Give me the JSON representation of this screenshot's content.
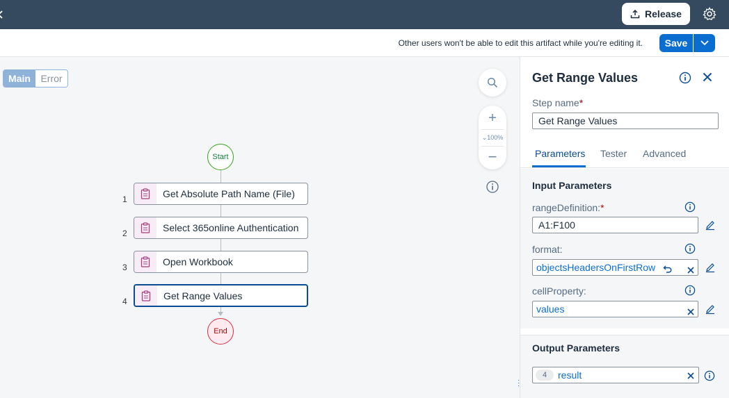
{
  "shell": {
    "release_label": "Release"
  },
  "toolbar": {
    "message": "Other users won't be able to edit this artifact while you're editing it.",
    "save_label": "Save"
  },
  "canvas": {
    "segments": [
      "Main",
      "Error"
    ],
    "selected_segment": "Main",
    "zoom_level": "100%",
    "start_label": "Start",
    "end_label": "End",
    "steps": [
      {
        "number": "1",
        "label": "Get Absolute Path Name (File)",
        "icon": "clipboard-icon"
      },
      {
        "number": "2",
        "label": "Select 365online Authentication",
        "icon": "clipboard-icon"
      },
      {
        "number": "3",
        "label": "Open Workbook",
        "icon": "clipboard-icon"
      },
      {
        "number": "4",
        "label": "Get Range Values",
        "icon": "clipboard-icon",
        "selected": true
      }
    ]
  },
  "panel": {
    "title": "Get Range Values",
    "step_name_label": "Step name",
    "step_name_value": "Get Range Values",
    "tabs": [
      "Parameters",
      "Tester",
      "Advanced"
    ],
    "active_tab": "Parameters",
    "input_section": "Input Parameters",
    "params": [
      {
        "label": "rangeDefinition:",
        "required": true,
        "value": "A1:F100"
      },
      {
        "label": "format:",
        "required": false,
        "value": "objectsHeadersOnFirstRow"
      },
      {
        "label": "cellProperty:",
        "required": false,
        "value": "values"
      }
    ],
    "output_section": "Output Parameters",
    "output": {
      "badge": "4",
      "value": "result"
    }
  },
  "colors": {
    "shell_bg": "#354a5f",
    "accent": "#0a6ed1",
    "start_green": "#107e3e",
    "end_red": "#aa0808",
    "required": "#aa0808"
  }
}
